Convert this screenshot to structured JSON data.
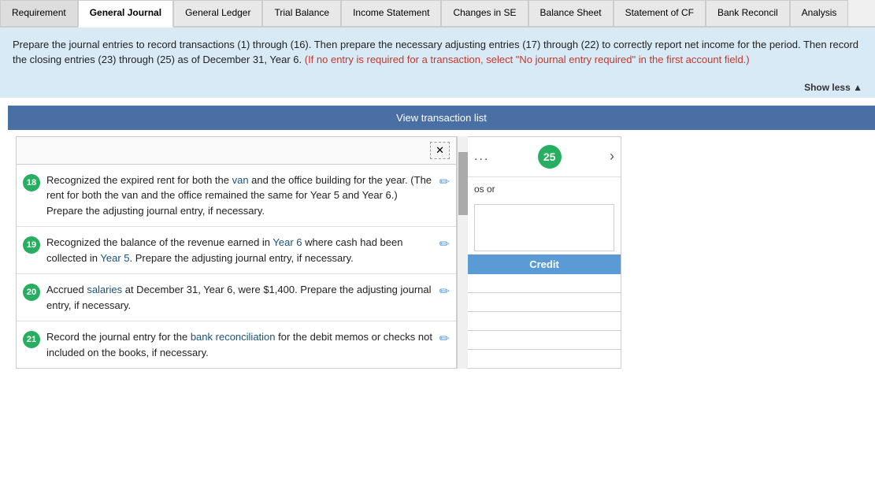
{
  "tabs": [
    {
      "id": "requirement",
      "label": "Requirement",
      "active": false
    },
    {
      "id": "general-journal",
      "label": "General Journal",
      "active": true
    },
    {
      "id": "general-ledger",
      "label": "General Ledger",
      "active": false
    },
    {
      "id": "trial-balance",
      "label": "Trial Balance",
      "active": false
    },
    {
      "id": "income-statement",
      "label": "Income Statement",
      "active": false
    },
    {
      "id": "changes-se",
      "label": "Changes in SE",
      "active": false
    },
    {
      "id": "balance-sheet",
      "label": "Balance Sheet",
      "active": false
    },
    {
      "id": "statement-of-cf",
      "label": "Statement of CF",
      "active": false
    },
    {
      "id": "bank-reconcil",
      "label": "Bank Reconcil",
      "active": false
    },
    {
      "id": "analysis",
      "label": "Analysis",
      "active": false
    }
  ],
  "info_box": {
    "main_text": "Prepare the journal entries to record transactions (1) through (16). Then prepare the necessary adjusting entries (17) through (22) to correctly report net income for the period. Then record the closing entries (23) through (25) as of December 31, Year 6.",
    "red_text": "(If no entry is required for a transaction, select \"No journal entry required\" in the first account field.)"
  },
  "show_less_label": "Show less",
  "view_transaction_label": "View transaction list",
  "x_btn_label": "✕",
  "transactions": [
    {
      "id": 18,
      "text_parts": [
        {
          "text": "Recognized the expired rent for both the ",
          "style": "normal"
        },
        {
          "text": "van",
          "style": "highlight"
        },
        {
          "text": " and the office building for the year. (The rent for both the van and the office remained the same for Year 5 and Year 6.) Prepare the adjusting journal entry, if necessary.",
          "style": "normal"
        }
      ]
    },
    {
      "id": 19,
      "text_parts": [
        {
          "text": "Recognized the balance of the revenue earned in ",
          "style": "normal"
        },
        {
          "text": "Year 6",
          "style": "highlight"
        },
        {
          "text": " where cash had been collected in ",
          "style": "normal"
        },
        {
          "text": "Year 5",
          "style": "highlight"
        },
        {
          "text": ". Prepare the adjusting journal entry, if necessary.",
          "style": "normal"
        }
      ]
    },
    {
      "id": 20,
      "text_parts": [
        {
          "text": "Accrued ",
          "style": "normal"
        },
        {
          "text": "salaries",
          "style": "highlight"
        },
        {
          "text": " at December 31, Year 6, were $1,400. Prepare the adjusting journal entry, if necessary.",
          "style": "normal"
        }
      ]
    },
    {
      "id": 21,
      "text_parts": [
        {
          "text": "Record the journal entry for the ",
          "style": "normal"
        },
        {
          "text": "bank reconciliation",
          "style": "highlight"
        },
        {
          "text": " for the debit memos or checks not included on the books, if necessary.",
          "style": "normal"
        }
      ]
    }
  ],
  "right_panel": {
    "dots": "...",
    "circle_number": "25",
    "partial_text": "os or",
    "credit_header": "Credit"
  },
  "colors": {
    "tab_active_bg": "#ffffff",
    "tab_inactive_bg": "#e8e8e8",
    "info_bg": "#d9eaf7",
    "badge_bg": "#27ae60",
    "circle_bg": "#27ae60",
    "highlight_text": "#1a5276",
    "red_text": "#c0392b",
    "view_btn_bg": "#4a6fa5",
    "credit_header_bg": "#5b9bd5"
  }
}
